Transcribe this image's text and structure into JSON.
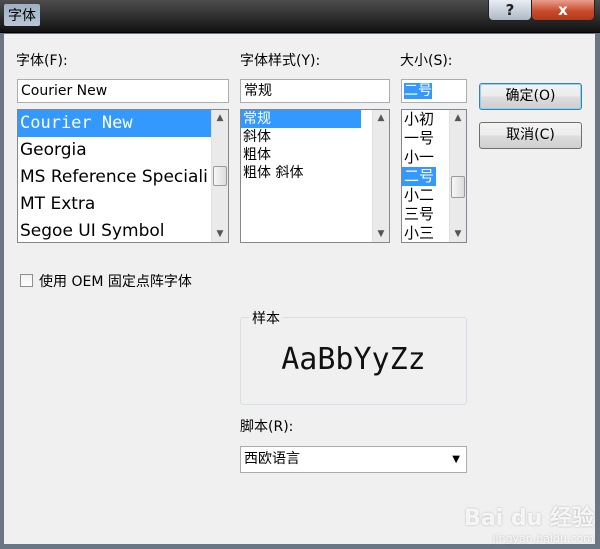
{
  "window": {
    "title": "字体",
    "help_label": "?",
    "close_label": "x"
  },
  "font": {
    "label": "字体(F):",
    "value": "Courier New",
    "items": [
      "Courier New",
      "Georgia",
      "MS Reference Speciali",
      "MT Extra",
      "Segoe UI Symbol"
    ]
  },
  "style": {
    "label": "字体样式(Y):",
    "value": "常规",
    "items": [
      "常规",
      "斜体",
      "粗体",
      "粗体 斜体"
    ]
  },
  "size": {
    "label": "大小(S):",
    "value": "二号",
    "items": [
      "小初",
      "一号",
      "小一",
      "二号",
      "小二",
      "三号",
      "小三"
    ]
  },
  "buttons": {
    "ok": "确定(O)",
    "cancel": "取消(C)"
  },
  "oem": {
    "label": "使用 OEM 固定点阵字体"
  },
  "sample": {
    "label": "样本",
    "text": "AaBbYyZz"
  },
  "script": {
    "label": "脚本(R):",
    "value": "西欧语言"
  },
  "watermark": {
    "brand": "Bai du 经验",
    "url": "jingyan.baidu.com"
  }
}
